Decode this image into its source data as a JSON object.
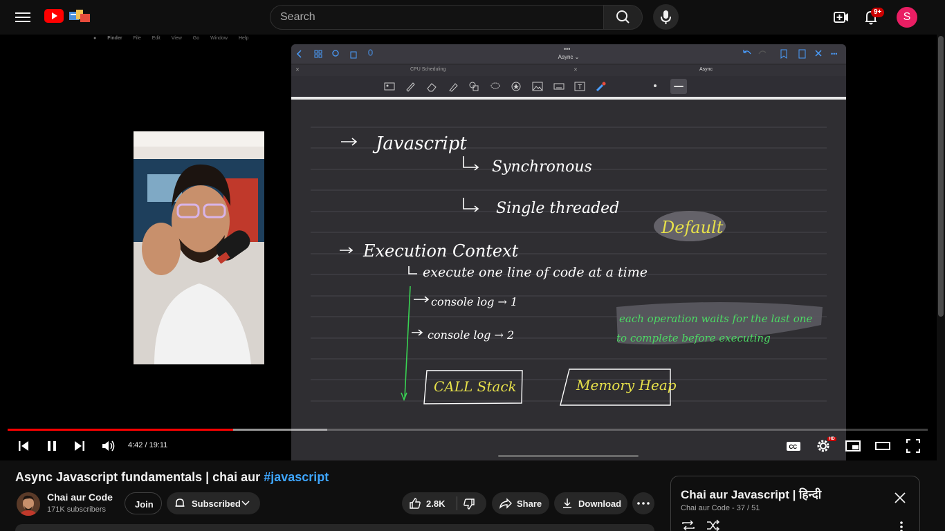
{
  "header": {
    "search_placeholder": "Search",
    "notifications_badge": "9+",
    "avatar_letter": "S"
  },
  "player": {
    "mac_menu": [
      "Finder",
      "File",
      "Edit",
      "View",
      "Go",
      "Window",
      "Help"
    ],
    "notes": {
      "doc_title": "Async",
      "tabs": [
        "CPU Scheduling",
        "Async"
      ],
      "lines": {
        "l1": "Javascript",
        "l2": "Synchronous",
        "l3": "Single threaded",
        "l4": "Default",
        "l5": "Execution Context",
        "l6": "execute one line of code at a time",
        "l7": "console log → 1",
        "l8": "console log → 2",
        "l9": "each operation waits for the last one",
        "l10": "to complete before executing",
        "l11": "CALL Stack",
        "l12": "Memory Heap"
      }
    },
    "current_time": "4:42",
    "duration": "19:11",
    "time_display": "4:42 / 19:11",
    "progress_fraction": 0.2454,
    "buffer_fraction": 0.347,
    "hd_label": "HD"
  },
  "video": {
    "title_text": "Async Javascript fundamentals | chai aur ",
    "title_tag": "#javascript",
    "channel_name": "Chai aur Code",
    "subscribers": "171K subscribers",
    "join_label": "Join",
    "subscribed_label": "Subscribed",
    "like_count": "2.8K",
    "share_label": "Share",
    "download_label": "Download"
  },
  "playlist": {
    "title": "Chai aur Javascript | हिन्दी",
    "channel": "Chai aur Code",
    "position": "37 / 51"
  },
  "colors": {
    "accent_red": "#ff0000",
    "link_blue": "#3ea6ff",
    "avatar_pink": "#e91e63",
    "highlight_yellow": "#e6e04a",
    "highlight_green": "#4cd964"
  }
}
